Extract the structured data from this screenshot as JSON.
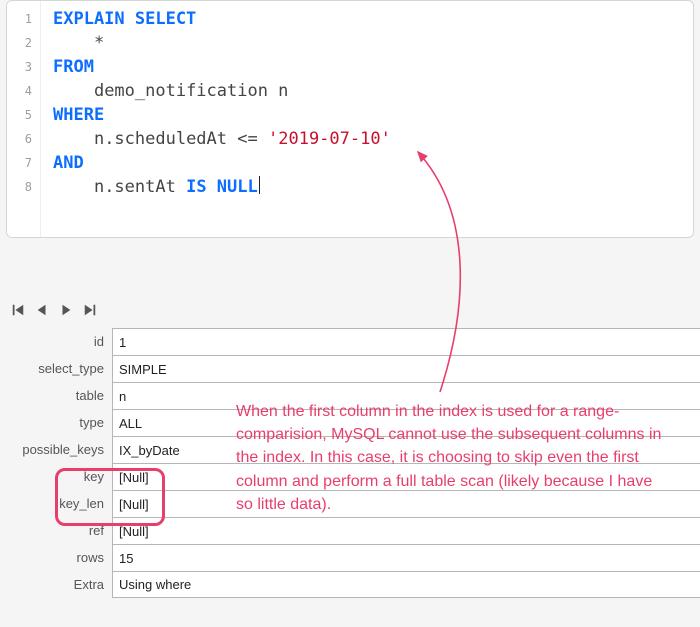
{
  "code": {
    "lines": [
      "1",
      "2",
      "3",
      "4",
      "5",
      "6",
      "7",
      "8"
    ],
    "kw_explain": "EXPLAIN SELECT",
    "star": "*",
    "kw_from": "FROM",
    "table_ident": "demo_notification n",
    "kw_where": "WHERE",
    "cond1_lhs": "n.scheduledAt",
    "cond1_op": "<=",
    "cond1_rhs": "'2019-07-10'",
    "kw_and": "AND",
    "cond2_lhs": "n.sentAt",
    "kw_isnull": "IS NULL"
  },
  "detail": {
    "rows": [
      {
        "label": "id",
        "value": "1"
      },
      {
        "label": "select_type",
        "value": "SIMPLE"
      },
      {
        "label": "table",
        "value": "n"
      },
      {
        "label": "type",
        "value": "ALL"
      },
      {
        "label": "possible_keys",
        "value": "IX_byDate"
      },
      {
        "label": "key",
        "value": "[Null]"
      },
      {
        "label": "key_len",
        "value": "[Null]"
      },
      {
        "label": "ref",
        "value": "[Null]"
      },
      {
        "label": "rows",
        "value": "15"
      },
      {
        "label": "Extra",
        "value": "Using where"
      }
    ]
  },
  "annotation": {
    "text": "When the first column in the index is used for a range-comparision, MySQL cannot use the subsequent columns in the index. In this case, it is choosing to skip even the first column and perform a full table scan (likely because I have so little data)."
  },
  "colors": {
    "accent": "#e83e6b",
    "keyword": "#0d6efd",
    "string": "#c8102e"
  }
}
